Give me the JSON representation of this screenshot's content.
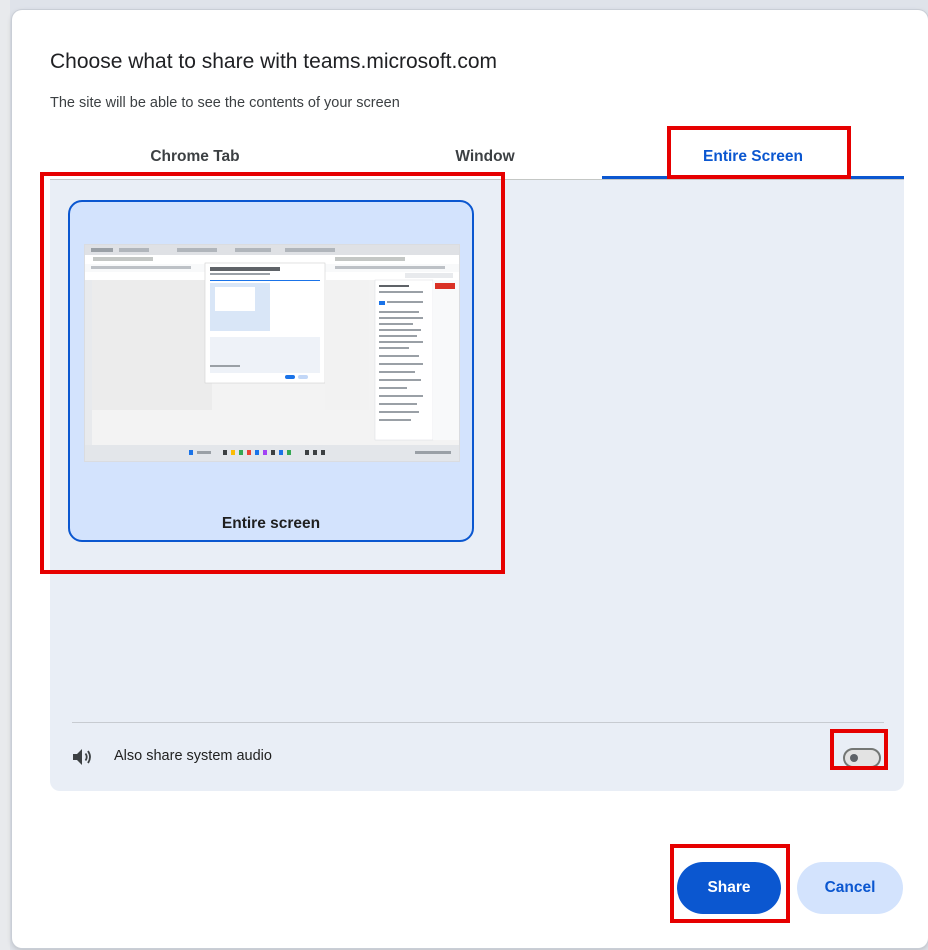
{
  "dialog": {
    "title": "Choose what to share with teams.microsoft.com",
    "subtitle": "The site will be able to see the contents of your screen"
  },
  "tabs": [
    {
      "label": "Chrome Tab",
      "selected": false
    },
    {
      "label": "Window",
      "selected": false
    },
    {
      "label": "Entire Screen",
      "selected": true
    }
  ],
  "sources": [
    {
      "label": "Entire screen",
      "selected": true
    }
  ],
  "audio": {
    "icon": "speaker-icon",
    "label": "Also share system audio",
    "enabled": false
  },
  "buttons": {
    "share_label": "Share",
    "cancel_label": "Cancel"
  },
  "colors": {
    "accent": "#0b57d0",
    "selection_bg": "#d3e3fd",
    "panel_bg": "#e9eef6",
    "annotation": "#e60000"
  }
}
